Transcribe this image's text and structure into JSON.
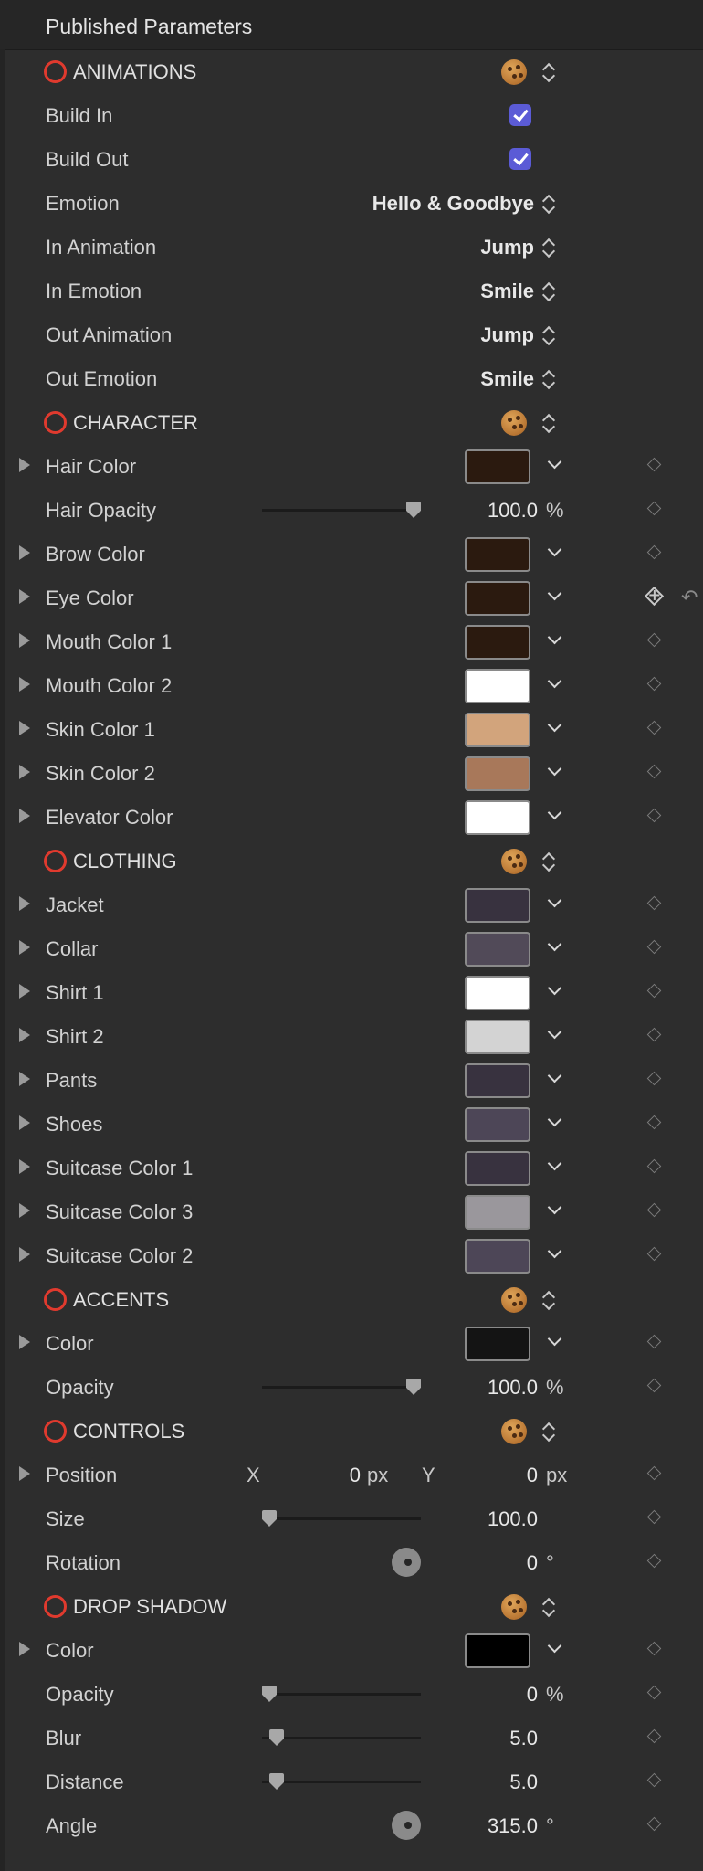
{
  "header": {
    "title": "Published Parameters"
  },
  "animations": {
    "title": "ANIMATIONS",
    "build_in": {
      "label": "Build In",
      "checked": true
    },
    "build_out": {
      "label": "Build Out",
      "checked": true
    },
    "emotion": {
      "label": "Emotion",
      "value": "Hello & Goodbye"
    },
    "in_animation": {
      "label": "In Animation",
      "value": "Jump"
    },
    "in_emotion": {
      "label": "In Emotion",
      "value": "Smile"
    },
    "out_animation": {
      "label": "Out Animation",
      "value": "Jump"
    },
    "out_emotion": {
      "label": "Out Emotion",
      "value": "Smile"
    }
  },
  "character": {
    "title": "CHARACTER",
    "hair_color": {
      "label": "Hair Color",
      "color": "#2b1a0f"
    },
    "hair_opacity": {
      "label": "Hair Opacity",
      "value": "100.0",
      "unit": "%",
      "level": 1.0
    },
    "brow_color": {
      "label": "Brow Color",
      "color": "#2b1a0f"
    },
    "eye_color": {
      "label": "Eye Color",
      "color": "#2b1a0f"
    },
    "mouth_color_1": {
      "label": "Mouth Color 1",
      "color": "#2b1a0f"
    },
    "mouth_color_2": {
      "label": "Mouth Color 2",
      "color": "#ffffff"
    },
    "skin_color_1": {
      "label": "Skin Color 1",
      "color": "#d2a47c"
    },
    "skin_color_2": {
      "label": "Skin Color 2",
      "color": "#a8785a"
    },
    "elevator_color": {
      "label": "Elevator Color",
      "color": "#ffffff"
    }
  },
  "clothing": {
    "title": "CLOTHING",
    "jacket": {
      "label": "Jacket",
      "color": "#38323f"
    },
    "collar": {
      "label": "Collar",
      "color": "#514a58"
    },
    "shirt_1": {
      "label": "Shirt 1",
      "color": "#ffffff"
    },
    "shirt_2": {
      "label": "Shirt 2",
      "color": "#d3d3d3"
    },
    "pants": {
      "label": "Pants",
      "color": "#38323f"
    },
    "shoes": {
      "label": "Shoes",
      "color": "#4d4657"
    },
    "suitcase_color_1": {
      "label": "Suitcase Color 1",
      "color": "#38323f"
    },
    "suitcase_color_3": {
      "label": "Suitcase Color 3",
      "color": "#9a979c"
    },
    "suitcase_color_2": {
      "label": "Suitcase Color 2",
      "color": "#4d4657"
    }
  },
  "accents": {
    "title": "ACCENTS",
    "color": {
      "label": "Color",
      "color": "#141414"
    },
    "opacity": {
      "label": "Opacity",
      "value": "100.0",
      "unit": "%",
      "level": 1.0
    }
  },
  "controls": {
    "title": "CONTROLS",
    "position": {
      "label": "Position",
      "x_label": "X",
      "x_value": "0",
      "x_unit": "px",
      "y_label": "Y",
      "y_value": "0",
      "y_unit": "px"
    },
    "size": {
      "label": "Size",
      "value": "100.0",
      "level": 0.0
    },
    "rotation": {
      "label": "Rotation",
      "value": "0",
      "unit": "°"
    }
  },
  "drop_shadow": {
    "title": "DROP SHADOW",
    "color": {
      "label": "Color",
      "color": "#000000"
    },
    "opacity": {
      "label": "Opacity",
      "value": "0",
      "unit": "%",
      "level": 0.0
    },
    "blur": {
      "label": "Blur",
      "value": "5.0",
      "level": 0.05
    },
    "distance": {
      "label": "Distance",
      "value": "5.0",
      "level": 0.05
    },
    "angle": {
      "label": "Angle",
      "value": "315.0",
      "unit": "°"
    }
  },
  "icons": {
    "group": "red-circle-icon",
    "preset": "cookie-icon",
    "stepper": "up-down-chevron-icon",
    "keyframe": "diamond-icon",
    "reset": "reset-arrow-icon"
  },
  "colors": {
    "checkbox": "#5b5bd6",
    "group_circle": "#e03a2e",
    "panel_bg": "#2d2d2d"
  }
}
